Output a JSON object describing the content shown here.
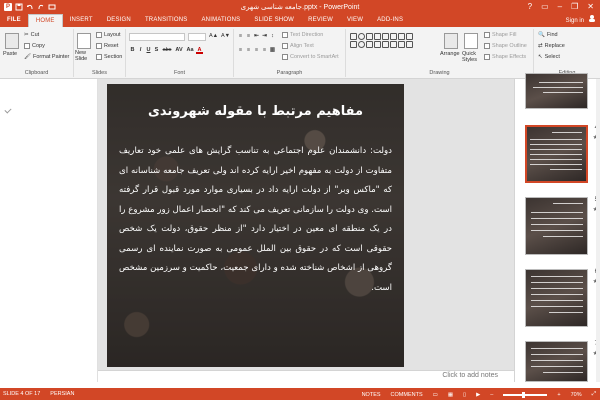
{
  "window": {
    "title": "جامعه شناسی شهری.pptx - PowerPoint",
    "controls": [
      "?",
      "▭",
      "–",
      "❐",
      "✕"
    ]
  },
  "tabs": [
    {
      "label": "FILE"
    },
    {
      "label": "HOME"
    },
    {
      "label": "INSERT"
    },
    {
      "label": "DESIGN"
    },
    {
      "label": "TRANSITIONS"
    },
    {
      "label": "ANIMATIONS"
    },
    {
      "label": "SLIDE SHOW"
    },
    {
      "label": "REVIEW"
    },
    {
      "label": "VIEW"
    },
    {
      "label": "ADD-INS"
    }
  ],
  "active_tab": "HOME",
  "signin": "Sign in",
  "ribbon": {
    "clipboard": {
      "label": "Clipboard",
      "paste": "Paste",
      "cut": "Cut",
      "copy": "Copy",
      "format_painter": "Format Painter"
    },
    "slides": {
      "label": "Slides",
      "new_slide": "New Slide",
      "layout": "Layout",
      "reset": "Reset",
      "section": "Section"
    },
    "font": {
      "label": "Font",
      "bold": "B",
      "italic": "I",
      "underline": "U",
      "shadow": "S",
      "strike": "abc",
      "spacing": "AV",
      "case": "Aa",
      "color": "A"
    },
    "paragraph": {
      "label": "Paragraph",
      "text_direction": "Text Direction",
      "align_text": "Align Text",
      "convert_smartart": "Convert to SmartArt"
    },
    "drawing": {
      "label": "Drawing",
      "arrange": "Arrange",
      "quick_styles": "Quick Styles",
      "shape_fill": "Shape Fill",
      "shape_outline": "Shape Outline",
      "shape_effects": "Shape Effects"
    },
    "editing": {
      "label": "Editing",
      "find": "Find",
      "replace": "Replace",
      "select": "Select"
    }
  },
  "slide": {
    "title": "مفاهیم مرتبط با مقوله شهروندی",
    "body": "دولت: دانشمندان علوم اجتماعی به تناسب گرایش های علمی خود تعاریف متفاوت از دولت به مفهوم اخیر ارایه کرده اند ولی تعریف جامعه شناسانه ای که \"ماکس وبر\" از دولت ارایه داد در بسیاری موارد مورد قبول قرار گرفته است. وی دولت را سازمانی تعریف می کند که \"انحصار اعمال زور مشروع را در یک منطقه ای معین در اختیار دارد \"از منظر حقوق، دولت یک شخص حقوقی است که در حقوق بین الملل عمومی به صورت نماینده ای رسمی گروهی از اشخاص شناخته شده و دارای جمعیت، حاکمیت و سرزمین مشخص است."
  },
  "notes_placeholder": "Click to add notes",
  "thumbnails": [
    {
      "num": "",
      "star": ""
    },
    {
      "num": "4",
      "star": "★",
      "selected": true
    },
    {
      "num": "5",
      "star": "★"
    },
    {
      "num": "6",
      "star": "★"
    },
    {
      "num": "7",
      "star": "★"
    }
  ],
  "status": {
    "slide": "SLIDE 4 OF 17",
    "language": "PERSIAN",
    "notes": "NOTES",
    "comments": "COMMENTS",
    "zoom": "70%",
    "zoom_level": 0.7
  },
  "colors": {
    "accent": "#d24726"
  }
}
